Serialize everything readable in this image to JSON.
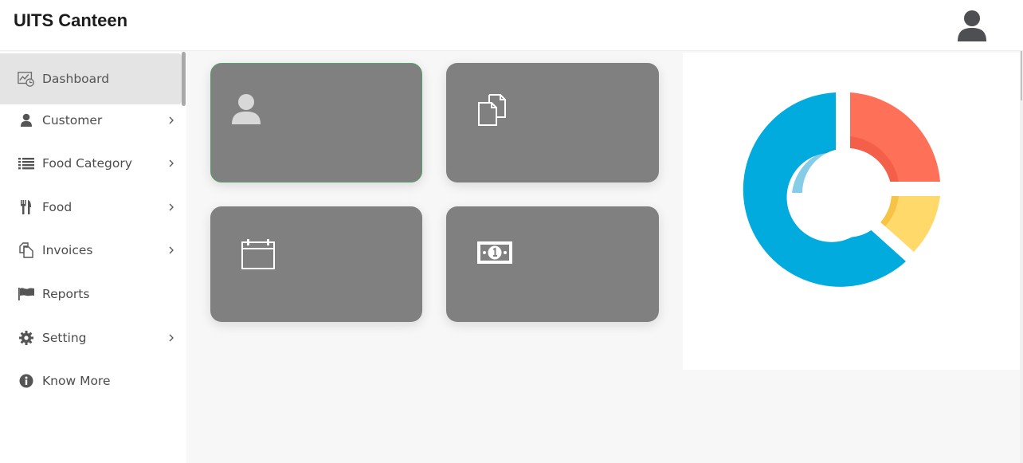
{
  "app": {
    "title": "UITS Canteen"
  },
  "header": {
    "user_icon": "user-avatar-icon"
  },
  "sidebar": {
    "items": [
      {
        "label": "Dashboard",
        "icon": "dashboard-icon",
        "active": true,
        "has_submenu": false
      },
      {
        "label": "Customer",
        "icon": "user-icon",
        "active": false,
        "has_submenu": true
      },
      {
        "label": "Food Category",
        "icon": "list-icon",
        "active": false,
        "has_submenu": true
      },
      {
        "label": "Food",
        "icon": "utensils-icon",
        "active": false,
        "has_submenu": true
      },
      {
        "label": "Invoices",
        "icon": "copy-icon",
        "active": false,
        "has_submenu": true
      },
      {
        "label": "Reports",
        "icon": "flag-icon",
        "active": false,
        "has_submenu": false
      },
      {
        "label": "Setting",
        "icon": "gear-icon",
        "active": false,
        "has_submenu": true
      },
      {
        "label": "Know More",
        "icon": "info-icon",
        "active": false,
        "has_submenu": false
      }
    ]
  },
  "cards": [
    {
      "icon": "user-icon"
    },
    {
      "icon": "documents-icon"
    },
    {
      "icon": "calendar-icon"
    },
    {
      "icon": "money-bill-icon"
    }
  ],
  "colors": {
    "card_bg": "#808080",
    "donut_blue": "#02abde",
    "donut_red": "#ff7058",
    "donut_yellow": "#ffd96a"
  }
}
